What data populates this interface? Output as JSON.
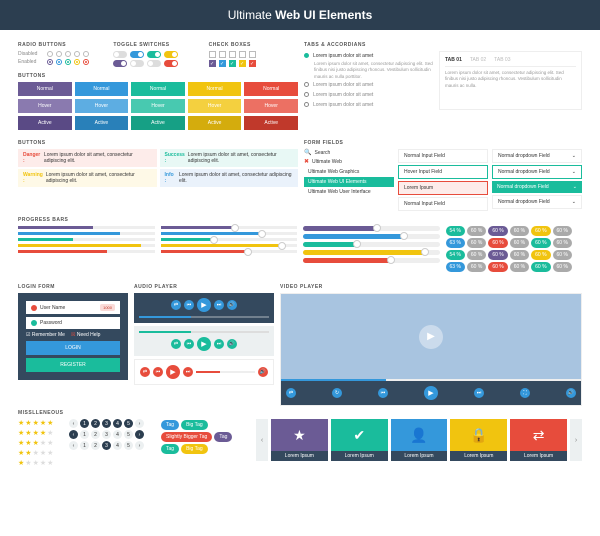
{
  "header": {
    "prefix": "Ultimate",
    "suffix": "Web UI Elements"
  },
  "sections": {
    "radio": "RADIO BUTTONS",
    "toggle": "TOGGLE SWITCHES",
    "check": "CHECK BOXES",
    "tabs": "TABS & ACCORDIANS",
    "buttons": "BUTTONS",
    "buttons2": "BUTTONS",
    "form": "FORM FIELDS",
    "progress": "PROGRESS BARS",
    "login": "LOGIN FORM",
    "audio": "AUDIO PLAYER",
    "video": "VIDEO PLAYER",
    "misc": "MISSLLENEOUS"
  },
  "radio_labels": {
    "disabled": "Disabled",
    "enabled": "Enabled"
  },
  "btn_states": {
    "normal": "Normal",
    "hover": "Hover",
    "active": "Active"
  },
  "alerts": {
    "danger": {
      "label": "Danger :",
      "text": "Lorem ipsum dolor sit amet, consectetur adipiscing elit."
    },
    "success": {
      "label": "Success :",
      "text": "Lorem ipsum dolor sit amet, consectetur adipiscing elit."
    },
    "warning": {
      "label": "Warning :",
      "text": "Lorem ipsum dolor sit amet, consectetur adipiscing elit."
    },
    "info": {
      "label": "Info :",
      "text": "Lorem ipsum dolor sit amet, consectetur adipiscing elit."
    }
  },
  "login": {
    "user": "User Name",
    "pass": "Password",
    "remember": "Remember Me",
    "help": "Need Help",
    "login_btn": "LOGIN",
    "register_btn": "REGISTER",
    "badge": "1000"
  },
  "tabs": {
    "t1": "TAB 01",
    "t2": "TAB 02",
    "t3": "TAB 03"
  },
  "accordion": {
    "title": "Lorem ipsum dolor sit amet",
    "body": "Lorem ipsum dolor sit amet, consectetur adipiscing elit. Sed finibus nisi justo adipiscing rhoncus. Vestibulum sollicitudin mauris ac nulla porttitor.",
    "item": "Lorem ipsum dolor sit amet"
  },
  "tab_content": "Lorem ipsum dolor sit amet, consectetur adipiscing elit. Sed finibus nisi justo adipiscing rhoncus. Vestibulum sollicitudin mauris ac nulla.",
  "form": {
    "search": "Search",
    "normal_input": "Normal Input Field",
    "normal_dd": "Normal dropdown Field",
    "hover_input": "Hover Input Field",
    "lorem": "Lorem Ipsum",
    "ac1": "Ultimate Web",
    "ac2": "Ultimate Web Graphics",
    "ac3": "Ultimate Web UI Elements",
    "ac4": "Ultimate Web User Interface"
  },
  "pills": {
    "p54": "54 %",
    "p60": "60 %",
    "p63": "63 %"
  },
  "tags": {
    "tag": "Tag",
    "big": "Big Tag",
    "slightly": "Slightly Bigger Tag"
  },
  "carousel_label": "Lorem Ipsum",
  "pager": {
    "prev": "‹",
    "next": "›",
    "nums": [
      "1",
      "2",
      "3",
      "4",
      "5"
    ]
  }
}
